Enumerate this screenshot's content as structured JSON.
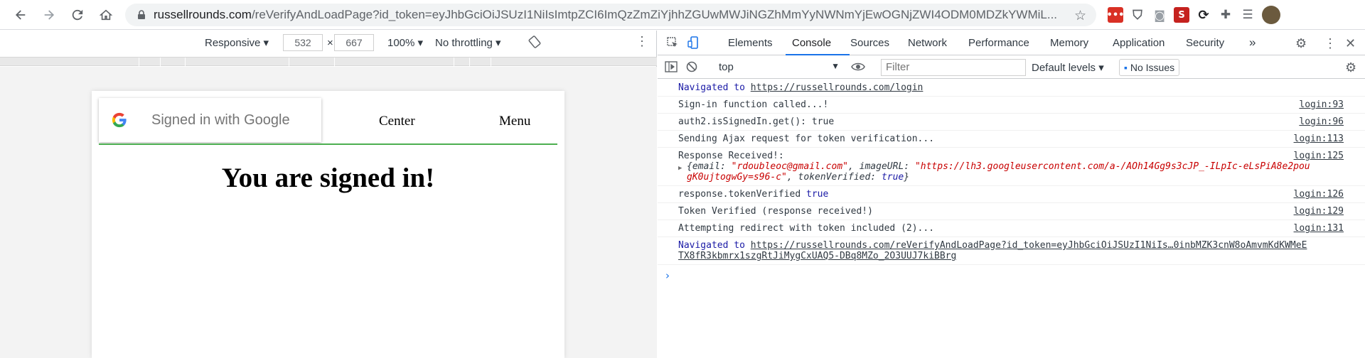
{
  "browser": {
    "url_host": "russellrounds.com",
    "url_path": "/reVerifyAndLoadPage?id_token=eyJhbGciOiJSUzI1NiIsImtpZCI6ImQzZmZiYjhhZGUwMWJiNGZhMmYyNWNmYjEwOGNjZWI4ODM0MDZkYWMiL..."
  },
  "device_toolbar": {
    "mode": "Responsive",
    "width": "532",
    "height": "667",
    "zoom": "100%",
    "throttling": "No throttling"
  },
  "page": {
    "google_button_label": "Signed in with Google",
    "nav_center": "Center",
    "nav_menu": "Menu",
    "headline": "You are signed in!"
  },
  "devtools": {
    "tabs": [
      "Elements",
      "Console",
      "Sources",
      "Network",
      "Performance",
      "Memory",
      "Application",
      "Security",
      "»"
    ],
    "active_tab": "Console",
    "context": "top",
    "filter_placeholder": "Filter",
    "levels": "Default levels",
    "issues": "No Issues"
  },
  "console": {
    "nav1_prefix": "Navigated to ",
    "nav1_url": "https://russellrounds.com/login",
    "logs": [
      {
        "text": "Sign-in function called...!",
        "src": "login:93"
      },
      {
        "text": "auth2.isSignedIn.get(): true",
        "src": "login:96"
      },
      {
        "text": "Sending Ajax request for token verification...",
        "src": "login:113"
      },
      {
        "text": "Response Received!:",
        "src": "login:125"
      }
    ],
    "obj_email_key": "email",
    "obj_email_val": "\"rdoubleoc@gmail.com\"",
    "obj_image_key": "imageURL",
    "obj_image_val_1": "\"https://lh3.googleusercontent.com/a-/AOh14Gg9s3cJP_-ILpIc-eLsPiA8e2pou",
    "obj_image_val_2": "gK0ujtogwGy=s96-c\"",
    "obj_token_key": "tokenVerified",
    "obj_token_val": "true",
    "logs2": [
      {
        "text": "response.tokenVerified",
        "value": "true",
        "src": "login:126"
      },
      {
        "text": "Token Verified (response received!)",
        "src": "login:129"
      },
      {
        "text": "Attempting redirect with token included (2)...",
        "src": "login:131"
      }
    ],
    "nav2_prefix": "Navigated to ",
    "nav2_url_1": "https://russellrounds.com/reVerifyAndLoadPage?id_token=eyJhbGciOiJSUzI1NiIs…0inbMZK3cnW8oAmvmKdKWMeE",
    "nav2_url_2": "TX8fR3kbmrx1szgRtJiMygCxUAQ5-DBq8MZo_2O3UUJ7kiBBrg",
    "prompt": "›"
  }
}
